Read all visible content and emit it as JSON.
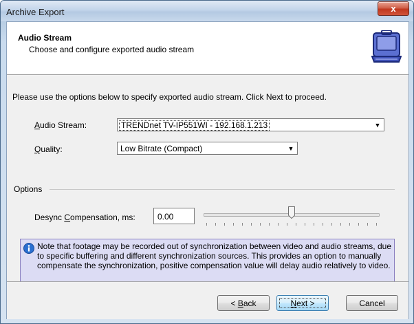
{
  "window": {
    "title": "Archive Export",
    "close_label": "x"
  },
  "header": {
    "title": "Audio Stream",
    "subtitle": "Choose and configure exported audio stream",
    "icon": "suitcase-icon"
  },
  "body": {
    "intro": "Please use the options below to specify exported audio stream. Click Next to proceed.",
    "audio_stream": {
      "label_pre": "",
      "label_u": "A",
      "label_post": "udio Stream:",
      "value": "TRENDnet TV-IP551WI - 192.168.1.213"
    },
    "quality": {
      "label_u": "Q",
      "label_post": "uality:",
      "value": "Low Bitrate (Compact)"
    },
    "options_group": "Options",
    "desync": {
      "label_pre": "Desync ",
      "label_u": "C",
      "label_post": "ompensation, ms:",
      "value": "0.00",
      "slider_fraction": 0.5
    },
    "note": "Note that footage may be recorded out of synchronization between video and audio streams, due to specific buffering and different synchronization sources. This provides an option to manually compensate the synchronization, positive compensation value will delay audio relatively to video."
  },
  "footer": {
    "back_pre": "< ",
    "back_u": "B",
    "back_post": "ack",
    "next_u": "N",
    "next_post": "ext >",
    "cancel": "Cancel"
  }
}
